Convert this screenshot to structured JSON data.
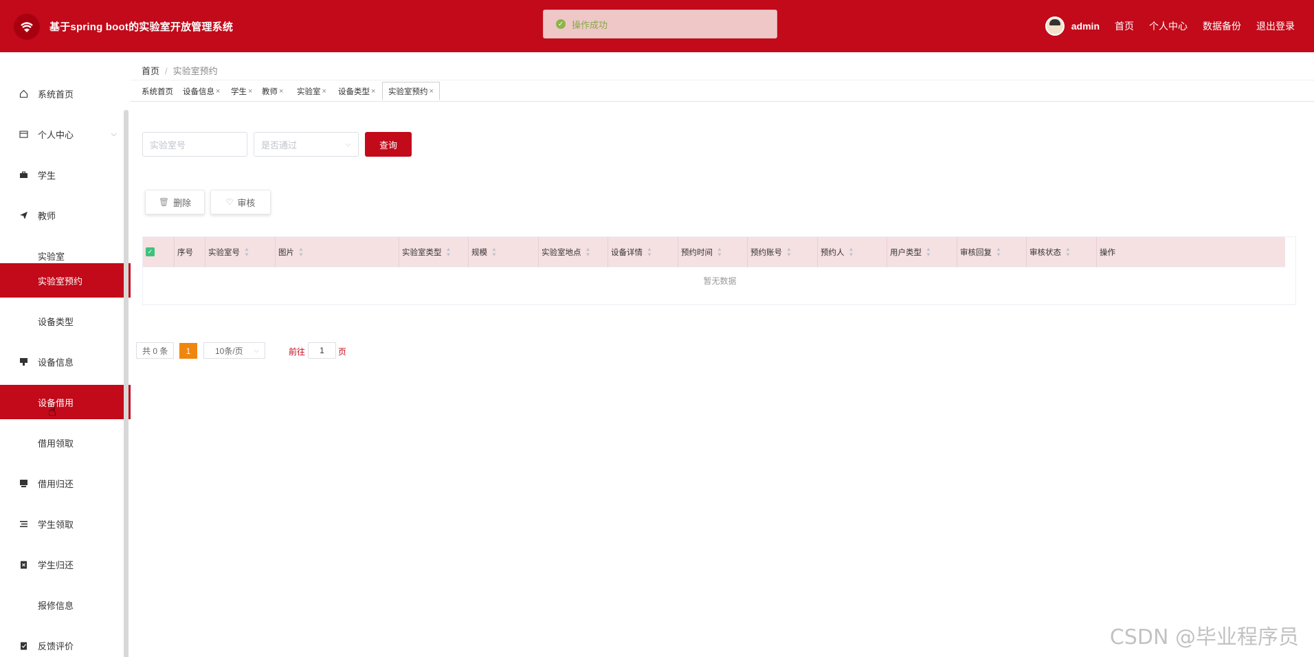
{
  "header": {
    "title": "基于spring boot的实验室开放管理系统",
    "toast": "操作成功",
    "user": "admin",
    "nav": [
      "首页",
      "个人中心",
      "数据备份",
      "退出登录"
    ]
  },
  "sidebar": {
    "items": [
      {
        "label": "系统首页",
        "icon": "home-icon"
      },
      {
        "label": "个人中心",
        "icon": "wallet-icon"
      },
      {
        "label": "学生",
        "icon": "briefcase-icon"
      },
      {
        "label": "教师",
        "icon": "send-icon"
      },
      {
        "label": "实验室",
        "icon": "grid-icon"
      },
      {
        "label": "实验室预约",
        "icon": "grid-icon"
      },
      {
        "label": "设备类型",
        "icon": "grid-icon"
      },
      {
        "label": "设备信息",
        "icon": "device-icon"
      },
      {
        "label": "设备借用",
        "icon": "grid-icon"
      },
      {
        "label": "借用领取",
        "icon": "grid-icon"
      },
      {
        "label": "借用归还",
        "icon": "monitor-icon"
      },
      {
        "label": "学生领取",
        "icon": "list-icon"
      },
      {
        "label": "学生归还",
        "icon": "clipboard-icon"
      },
      {
        "label": "报修信息",
        "icon": "grid-icon"
      },
      {
        "label": "反馈评价",
        "icon": "check-icon"
      }
    ]
  },
  "breadcrumb": {
    "home": "首页",
    "current": "实验室预约"
  },
  "tabs": [
    "系统首页",
    "设备信息",
    "学生",
    "教师",
    "实验室",
    "设备类型",
    "实验室预约"
  ],
  "search": {
    "lab_no_placeholder": "实验室号",
    "approved_placeholder": "是否通过",
    "button": "查询"
  },
  "actions": {
    "delete": "删除",
    "review": "审核"
  },
  "table": {
    "columns": [
      "序号",
      "实验室号",
      "图片",
      "实验室类型",
      "规模",
      "实验室地点",
      "设备详情",
      "预约时间",
      "预约账号",
      "预约人",
      "用户类型",
      "审核回复",
      "审核状态",
      "操作"
    ],
    "empty_text": "暂无数据"
  },
  "pagination": {
    "total": "共 0 条",
    "current": "1",
    "page_size": "10条/页",
    "goto": "前往",
    "goto_value": "1",
    "page_suffix": "页"
  },
  "watermark": "CSDN @毕业程序员",
  "colors": {
    "primary": "#c20a1a",
    "table_header": "#f5e0e2",
    "pager_active": "#f0860e"
  }
}
